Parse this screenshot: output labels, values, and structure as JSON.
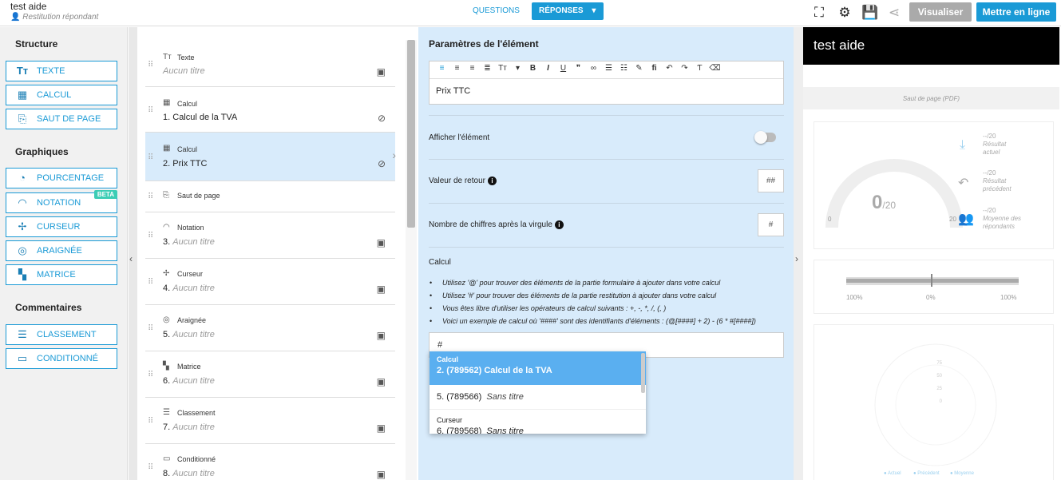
{
  "header": {
    "app_title": "test aide",
    "app_subtitle": "Restitution répondant",
    "tab_questions": "QUESTIONS",
    "tab_reponses": "RÉPONSES",
    "btn_visualiser": "Visualiser",
    "btn_publier": "Mettre en ligne"
  },
  "toolbox": {
    "structure_title": "Structure",
    "structure": [
      {
        "label": "TEXTE",
        "icon": "text-icon"
      },
      {
        "label": "CALCUL",
        "icon": "calculator-icon"
      },
      {
        "label": "SAUT DE PAGE",
        "icon": "page-break-icon"
      }
    ],
    "graphiques_title": "Graphiques",
    "graphiques": [
      {
        "label": "POURCENTAGE",
        "icon": "pie-icon"
      },
      {
        "label": "NOTATION",
        "icon": "gauge-icon",
        "badge": "BETA"
      },
      {
        "label": "CURSEUR",
        "icon": "slider-icon"
      },
      {
        "label": "ARAIGNÉE",
        "icon": "radar-icon"
      },
      {
        "label": "MATRICE",
        "icon": "matrix-icon"
      }
    ],
    "commentaires_title": "Commentaires",
    "commentaires": [
      {
        "label": "CLASSEMENT",
        "icon": "list-icon"
      },
      {
        "label": "CONDITIONNÉ",
        "icon": "comment-icon"
      }
    ]
  },
  "elements": [
    {
      "type": "Texte",
      "number": "",
      "title": "Aucun titre",
      "untitled": true
    },
    {
      "type": "Calcul",
      "number": "1.",
      "title": "Calcul de la TVA",
      "untitled": false
    },
    {
      "type": "Calcul",
      "number": "2.",
      "title": "Prix TTC",
      "untitled": false
    },
    {
      "type": "Saut de page",
      "number": "",
      "title": "",
      "untitled": false
    },
    {
      "type": "Notation",
      "number": "3.",
      "title": "Aucun titre",
      "untitled": true
    },
    {
      "type": "Curseur",
      "number": "4.",
      "title": "Aucun titre",
      "untitled": true
    },
    {
      "type": "Araignée",
      "number": "5.",
      "title": "Aucun titre",
      "untitled": true
    },
    {
      "type": "Matrice",
      "number": "6.",
      "title": "Aucun titre",
      "untitled": true
    },
    {
      "type": "Classement",
      "number": "7.",
      "title": "Aucun titre",
      "untitled": true
    },
    {
      "type": "Conditionné",
      "number": "8.",
      "title": "Aucun titre",
      "untitled": true
    }
  ],
  "params": {
    "title": "Paramètres de l'élément",
    "editor_text": "Prix TTC",
    "afficher_label": "Afficher l'élément",
    "afficher_value": false,
    "valeur_retour_label": "Valeur de retour",
    "valeur_retour_value": "##",
    "nb_chiffres_label": "Nombre de chiffres après la virgule",
    "nb_chiffres_value": "#",
    "calcul_label": "Calcul",
    "help": [
      "Utilisez '@' pour trouver des éléments de la partie formulaire à ajouter dans votre calcul",
      "Utilisez '#' pour trouver des éléments de la partie restitution à ajouter dans votre calcul",
      "Vous êtes libre d'utiliser les opérateurs de calcul suivants : +, -, *, /, (, )",
      "Voici un exemple de calcul où '####' sont des identifiants d'éléments : (@[####] + 2) - (6 * #[####])"
    ],
    "calcul_value": "#"
  },
  "dropdown": {
    "selected_cat": "Calcul",
    "selected_text": "2. (789562)  Calcul de la TVA",
    "row1_prefix": "5. (789566)",
    "row1_title": "Sans titre",
    "cat2": "Curseur",
    "row2_prefix": "6. (789568)",
    "row2_title": "Sans titre"
  },
  "preview": {
    "title": "test aide",
    "page_break": "Saut de page (PDF)",
    "gauge_value": "0",
    "gauge_max": "/20",
    "gauge_min_label": "0",
    "gauge_max_label": "20",
    "side": [
      {
        "value": "--/20",
        "label1": "Résultat",
        "label2": "actuel"
      },
      {
        "value": "--/20",
        "label1": "Résultat",
        "label2": "précédent"
      },
      {
        "value": "--/20",
        "label1": "Moyenne des",
        "label2": "répondants"
      }
    ],
    "slider_left": "100%",
    "slider_mid": "0%",
    "slider_right": "100%",
    "radar_ticks": [
      "75",
      "50",
      "25",
      "0"
    ],
    "legend": [
      "Actuel",
      "Précédent",
      "Moyenne"
    ]
  }
}
